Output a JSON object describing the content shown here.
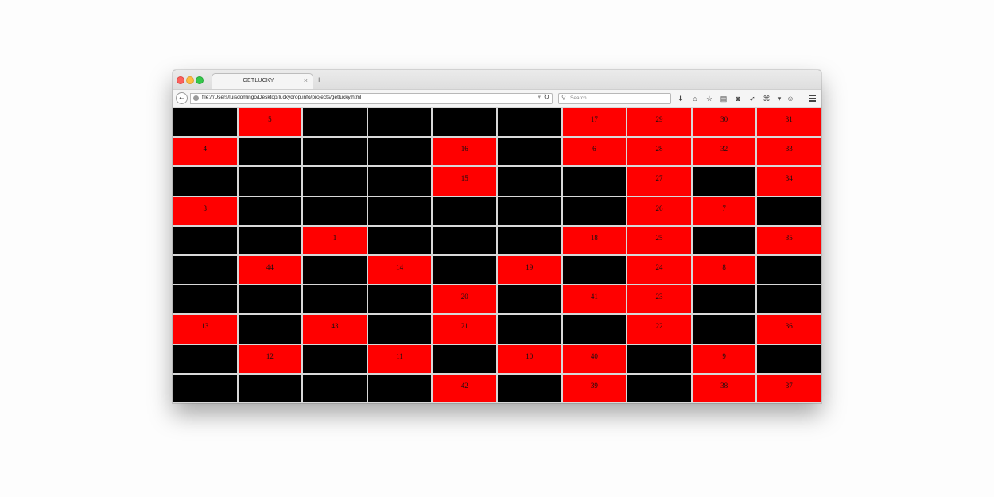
{
  "browser": {
    "tab_title": "GETLUCKY",
    "tab_close": "×",
    "new_tab": "+",
    "back": "←",
    "url": "file:///Users/luisdomingo/Desktop/luckydrop.info/projects/getlucky.html",
    "url_dropdown": "▾",
    "reload": "↻",
    "search_placeholder": "Search",
    "search_glyph": "⚲",
    "toolbar_icons": [
      {
        "name": "download-icon",
        "glyph": "⬇"
      },
      {
        "name": "home-icon",
        "glyph": "⌂"
      },
      {
        "name": "bookmark-star-icon",
        "glyph": "☆"
      },
      {
        "name": "bookmarks-library-icon",
        "glyph": "▤"
      },
      {
        "name": "pocket-icon",
        "glyph": "◙"
      },
      {
        "name": "send-icon",
        "glyph": "➶"
      },
      {
        "name": "translate-icon",
        "glyph": "⌘"
      },
      {
        "name": "overflow-chevron-icon",
        "glyph": "▾"
      },
      {
        "name": "emoji-icon",
        "glyph": "☺"
      }
    ]
  },
  "board": {
    "colors": {
      "red": "#ff0000",
      "black": "#000000"
    },
    "cells": [
      [
        {
          "c": "b",
          "n": ""
        },
        {
          "c": "r",
          "n": "5"
        },
        {
          "c": "b",
          "n": ""
        },
        {
          "c": "b",
          "n": ""
        },
        {
          "c": "b",
          "n": ""
        },
        {
          "c": "b",
          "n": ""
        },
        {
          "c": "r",
          "n": "17"
        },
        {
          "c": "r",
          "n": "29"
        },
        {
          "c": "r",
          "n": "30"
        },
        {
          "c": "r",
          "n": "31"
        }
      ],
      [
        {
          "c": "r",
          "n": "4"
        },
        {
          "c": "b",
          "n": ""
        },
        {
          "c": "b",
          "n": ""
        },
        {
          "c": "b",
          "n": ""
        },
        {
          "c": "r",
          "n": "16"
        },
        {
          "c": "b",
          "n": ""
        },
        {
          "c": "r",
          "n": "6"
        },
        {
          "c": "r",
          "n": "28"
        },
        {
          "c": "r",
          "n": "32"
        },
        {
          "c": "r",
          "n": "33"
        }
      ],
      [
        {
          "c": "b",
          "n": ""
        },
        {
          "c": "b",
          "n": ""
        },
        {
          "c": "b",
          "n": ""
        },
        {
          "c": "b",
          "n": ""
        },
        {
          "c": "r",
          "n": "15"
        },
        {
          "c": "b",
          "n": ""
        },
        {
          "c": "b",
          "n": ""
        },
        {
          "c": "r",
          "n": "27"
        },
        {
          "c": "b",
          "n": ""
        },
        {
          "c": "r",
          "n": "34"
        }
      ],
      [
        {
          "c": "r",
          "n": "3"
        },
        {
          "c": "b",
          "n": ""
        },
        {
          "c": "b",
          "n": ""
        },
        {
          "c": "b",
          "n": ""
        },
        {
          "c": "b",
          "n": ""
        },
        {
          "c": "b",
          "n": ""
        },
        {
          "c": "b",
          "n": ""
        },
        {
          "c": "r",
          "n": "26"
        },
        {
          "c": "r",
          "n": "7"
        },
        {
          "c": "b",
          "n": ""
        }
      ],
      [
        {
          "c": "b",
          "n": ""
        },
        {
          "c": "b",
          "n": ""
        },
        {
          "c": "r",
          "n": "1"
        },
        {
          "c": "b",
          "n": ""
        },
        {
          "c": "b",
          "n": ""
        },
        {
          "c": "b",
          "n": ""
        },
        {
          "c": "r",
          "n": "18"
        },
        {
          "c": "r",
          "n": "25"
        },
        {
          "c": "b",
          "n": ""
        },
        {
          "c": "r",
          "n": "35"
        }
      ],
      [
        {
          "c": "b",
          "n": ""
        },
        {
          "c": "r",
          "n": "44"
        },
        {
          "c": "b",
          "n": ""
        },
        {
          "c": "r",
          "n": "14"
        },
        {
          "c": "b",
          "n": ""
        },
        {
          "c": "r",
          "n": "19"
        },
        {
          "c": "b",
          "n": ""
        },
        {
          "c": "r",
          "n": "24"
        },
        {
          "c": "r",
          "n": "8"
        },
        {
          "c": "b",
          "n": ""
        }
      ],
      [
        {
          "c": "b",
          "n": ""
        },
        {
          "c": "b",
          "n": ""
        },
        {
          "c": "b",
          "n": ""
        },
        {
          "c": "b",
          "n": ""
        },
        {
          "c": "r",
          "n": "20"
        },
        {
          "c": "b",
          "n": ""
        },
        {
          "c": "r",
          "n": "41"
        },
        {
          "c": "r",
          "n": "23"
        },
        {
          "c": "b",
          "n": ""
        },
        {
          "c": "b",
          "n": ""
        }
      ],
      [
        {
          "c": "r",
          "n": "13"
        },
        {
          "c": "b",
          "n": ""
        },
        {
          "c": "r",
          "n": "43"
        },
        {
          "c": "b",
          "n": ""
        },
        {
          "c": "r",
          "n": "21"
        },
        {
          "c": "b",
          "n": ""
        },
        {
          "c": "b",
          "n": ""
        },
        {
          "c": "r",
          "n": "22"
        },
        {
          "c": "b",
          "n": ""
        },
        {
          "c": "r",
          "n": "36"
        }
      ],
      [
        {
          "c": "b",
          "n": ""
        },
        {
          "c": "r",
          "n": "12"
        },
        {
          "c": "b",
          "n": ""
        },
        {
          "c": "r",
          "n": "11"
        },
        {
          "c": "b",
          "n": ""
        },
        {
          "c": "r",
          "n": "10"
        },
        {
          "c": "r",
          "n": "40"
        },
        {
          "c": "b",
          "n": ""
        },
        {
          "c": "r",
          "n": "9"
        },
        {
          "c": "b",
          "n": ""
        }
      ],
      [
        {
          "c": "b",
          "n": ""
        },
        {
          "c": "b",
          "n": ""
        },
        {
          "c": "b",
          "n": ""
        },
        {
          "c": "b",
          "n": ""
        },
        {
          "c": "r",
          "n": "42"
        },
        {
          "c": "b",
          "n": ""
        },
        {
          "c": "r",
          "n": "39"
        },
        {
          "c": "b",
          "n": ""
        },
        {
          "c": "r",
          "n": "38"
        },
        {
          "c": "r",
          "n": "37"
        }
      ]
    ]
  }
}
